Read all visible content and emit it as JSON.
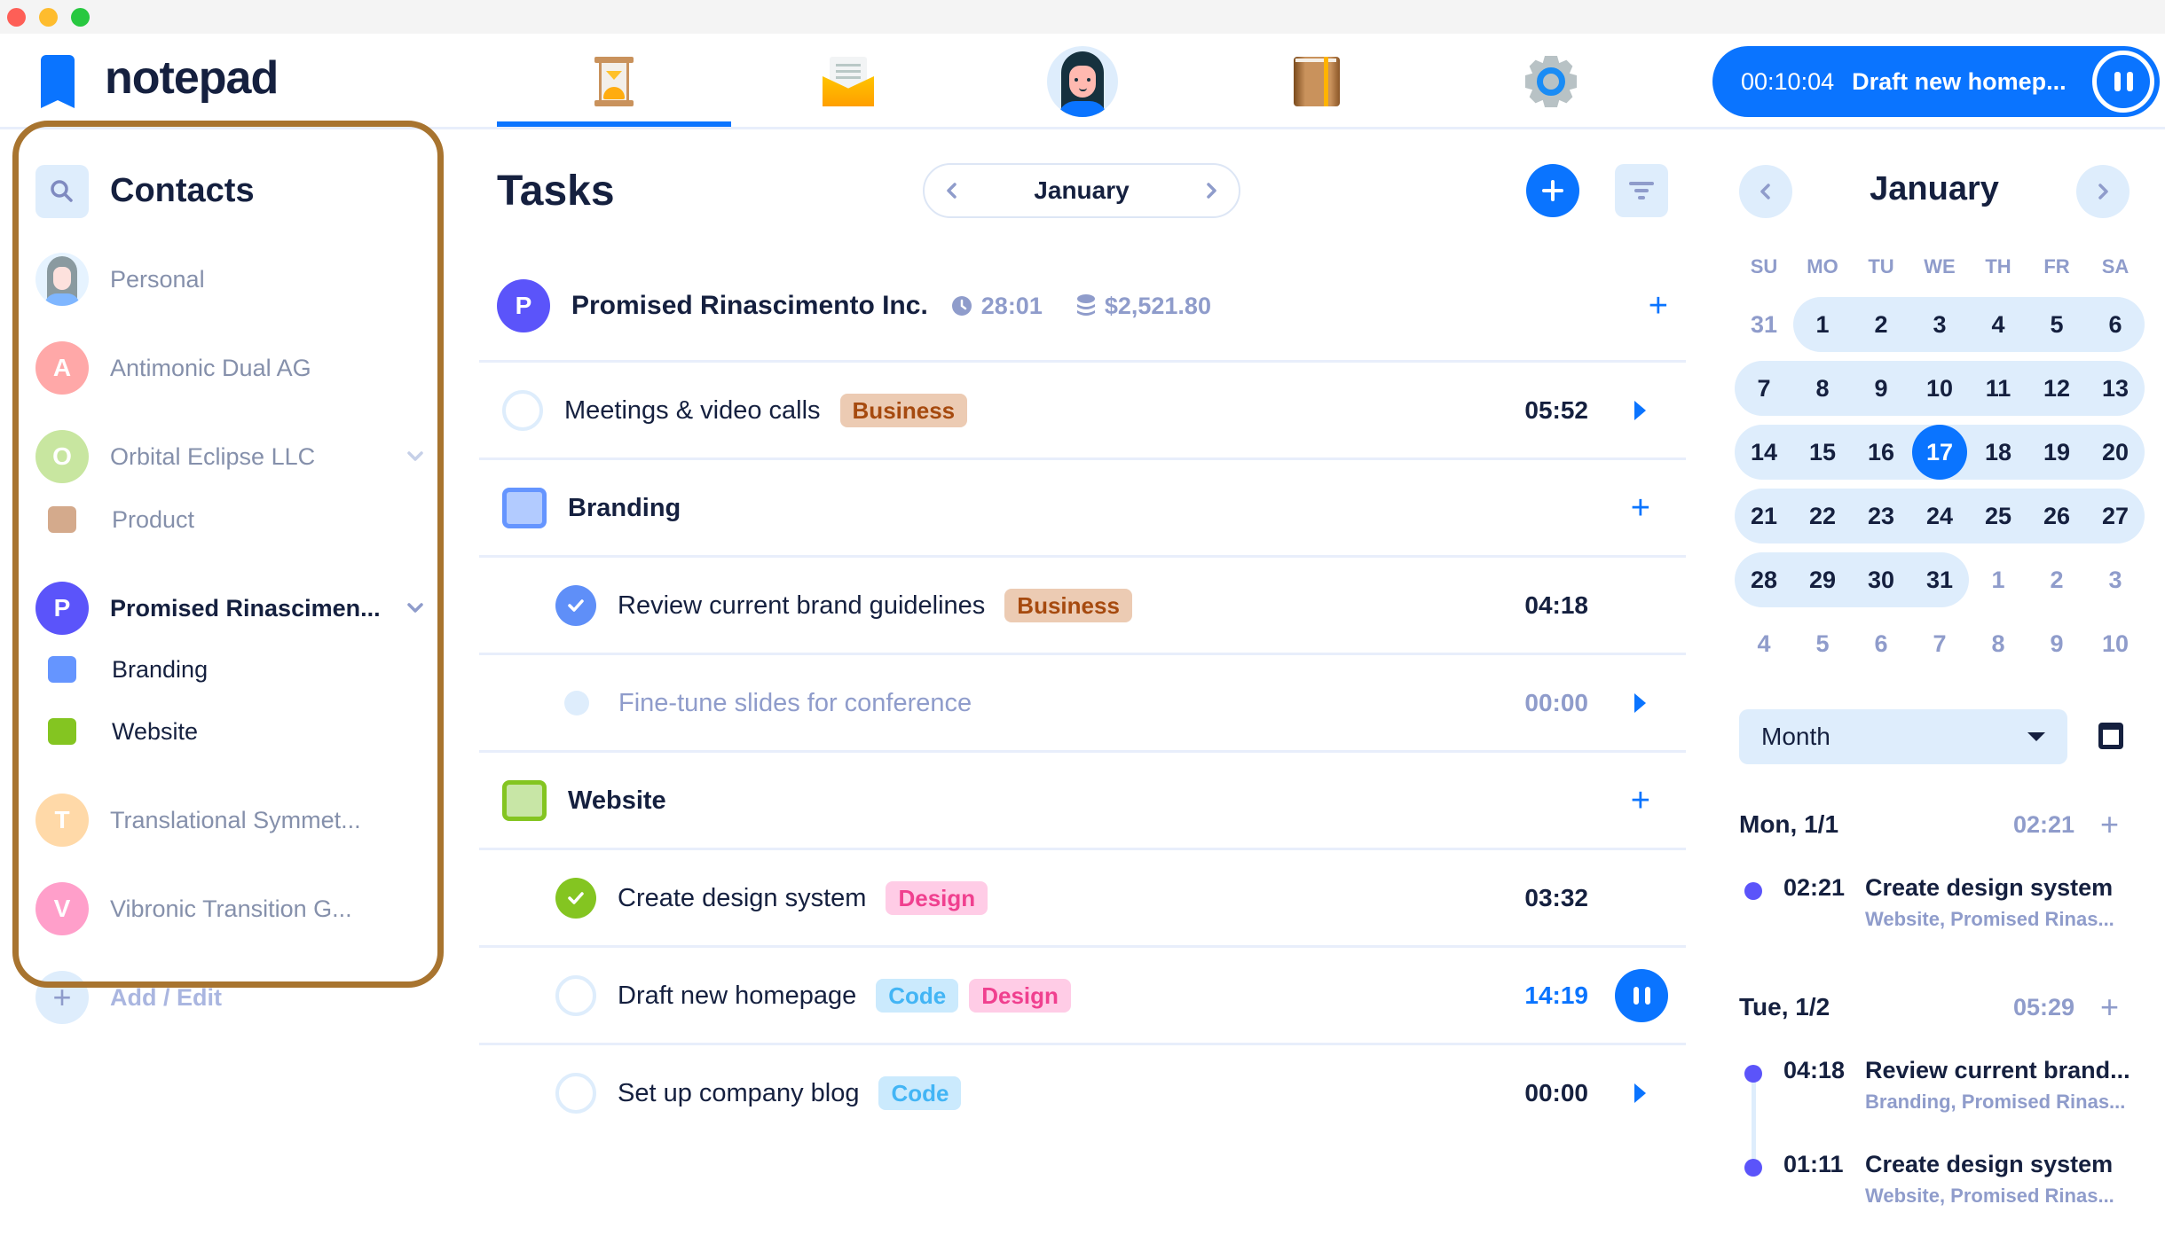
{
  "app": {
    "name": "notepad",
    "colors": {
      "accent": "#0a74ff",
      "text": "#15203f",
      "muted": "#8f9ccb",
      "highlight_frame": "#a8742f"
    }
  },
  "window_controls": [
    "close",
    "minimize",
    "maximize"
  ],
  "nav": {
    "tabs": [
      {
        "name": "time-tracking",
        "icon": "hourglass-icon",
        "active": true
      },
      {
        "name": "messages",
        "icon": "mail-icon",
        "active": false
      },
      {
        "name": "profile",
        "icon": "avatar-icon",
        "active": false
      },
      {
        "name": "notebook",
        "icon": "book-icon",
        "active": false
      },
      {
        "name": "settings",
        "icon": "gear-icon",
        "active": false
      }
    ]
  },
  "timer": {
    "elapsed": "00:10:04",
    "task": "Draft new homep..."
  },
  "sidebar": {
    "title": "Contacts",
    "items": [
      {
        "label": "Personal",
        "type": "contact",
        "avatar": "photo"
      },
      {
        "label": "Antimonic Dual AG",
        "type": "contact",
        "initial": "A",
        "color": "#ffa8a8"
      },
      {
        "label": "Orbital Eclipse LLC",
        "type": "contact",
        "initial": "O",
        "color": "#c8e6a0",
        "expanded": true
      },
      {
        "label": "Product",
        "type": "project",
        "color": "#d4aa8c"
      },
      {
        "label": "Promised Rinascimen...",
        "type": "contact",
        "initial": "P",
        "color": "#5b54fa",
        "expanded": true,
        "active": true
      },
      {
        "label": "Branding",
        "type": "project",
        "color": "#6595ff"
      },
      {
        "label": "Website",
        "type": "project",
        "color": "#84c521"
      },
      {
        "label": "Translational Symmet...",
        "type": "contact",
        "initial": "T",
        "color": "#ffd9a8"
      },
      {
        "label": "Vibronic Transition G...",
        "type": "contact",
        "initial": "V",
        "color": "#ff9fca"
      }
    ],
    "add_edit_label": "Add / Edit"
  },
  "tasks": {
    "title": "Tasks",
    "month": "January",
    "company": {
      "initial": "P",
      "name": "Promised Rinascimento Inc.",
      "time": "28:01",
      "amount": "$2,521.80"
    },
    "rows": [
      {
        "kind": "task",
        "label": "Meetings & video calls",
        "tags": [
          "Business"
        ],
        "time": "05:52",
        "status": "open",
        "action": "play",
        "indent": 0
      },
      {
        "kind": "group",
        "label": "Branding",
        "color": "branding"
      },
      {
        "kind": "task",
        "label": "Review current brand guidelines",
        "tags": [
          "Business"
        ],
        "time": "04:18",
        "status": "done-blue",
        "action": "none",
        "indent": 1
      },
      {
        "kind": "task",
        "label": "Fine-tune slides for conference",
        "tags": [],
        "time": "00:00",
        "status": "subtask",
        "action": "play",
        "indent": 1,
        "muted": true
      },
      {
        "kind": "group",
        "label": "Website",
        "color": "website"
      },
      {
        "kind": "task",
        "label": "Create design system",
        "tags": [
          "Design"
        ],
        "time": "03:32",
        "status": "done-green",
        "action": "none",
        "indent": 1
      },
      {
        "kind": "task",
        "label": "Draft new homepage",
        "tags": [
          "Code",
          "Design"
        ],
        "time": "14:19",
        "status": "open",
        "action": "pause",
        "indent": 1,
        "running": true
      },
      {
        "kind": "task",
        "label": "Set up company blog",
        "tags": [
          "Code"
        ],
        "time": "00:00",
        "status": "open",
        "action": "play",
        "indent": 1
      }
    ]
  },
  "calendar": {
    "title": "January",
    "weekdays": [
      "SU",
      "MO",
      "TU",
      "WE",
      "TH",
      "FR",
      "SA"
    ],
    "weeks": [
      [
        {
          "d": "31",
          "o": true
        },
        {
          "d": "1"
        },
        {
          "d": "2"
        },
        {
          "d": "3"
        },
        {
          "d": "4"
        },
        {
          "d": "5"
        },
        {
          "d": "6"
        }
      ],
      [
        {
          "d": "7"
        },
        {
          "d": "8"
        },
        {
          "d": "9"
        },
        {
          "d": "10"
        },
        {
          "d": "11"
        },
        {
          "d": "12"
        },
        {
          "d": "13"
        }
      ],
      [
        {
          "d": "14"
        },
        {
          "d": "15"
        },
        {
          "d": "16"
        },
        {
          "d": "17",
          "today": true
        },
        {
          "d": "18"
        },
        {
          "d": "19"
        },
        {
          "d": "20"
        }
      ],
      [
        {
          "d": "21"
        },
        {
          "d": "22"
        },
        {
          "d": "23"
        },
        {
          "d": "24"
        },
        {
          "d": "25"
        },
        {
          "d": "26"
        },
        {
          "d": "27"
        }
      ],
      [
        {
          "d": "28"
        },
        {
          "d": "29"
        },
        {
          "d": "30"
        },
        {
          "d": "31"
        },
        {
          "d": "1",
          "o": true
        },
        {
          "d": "2",
          "o": true
        },
        {
          "d": "3",
          "o": true
        }
      ],
      [
        {
          "d": "4",
          "o": true
        },
        {
          "d": "5",
          "o": true
        },
        {
          "d": "6",
          "o": true
        },
        {
          "d": "7",
          "o": true
        },
        {
          "d": "8",
          "o": true
        },
        {
          "d": "9",
          "o": true
        },
        {
          "d": "10",
          "o": true
        }
      ]
    ],
    "view": "Month",
    "days": [
      {
        "label": "Mon, 1/1",
        "total": "02:21",
        "entries": [
          {
            "time": "02:21",
            "title": "Create design system",
            "sub": "Website, Promised Rinas..."
          }
        ]
      },
      {
        "label": "Tue, 1/2",
        "total": "05:29",
        "entries": [
          {
            "time": "04:18",
            "title": "Review current brand...",
            "sub": "Branding, Promised Rinas..."
          },
          {
            "time": "01:11",
            "title": "Create design system",
            "sub": "Website, Promised Rinas..."
          }
        ]
      }
    ]
  }
}
